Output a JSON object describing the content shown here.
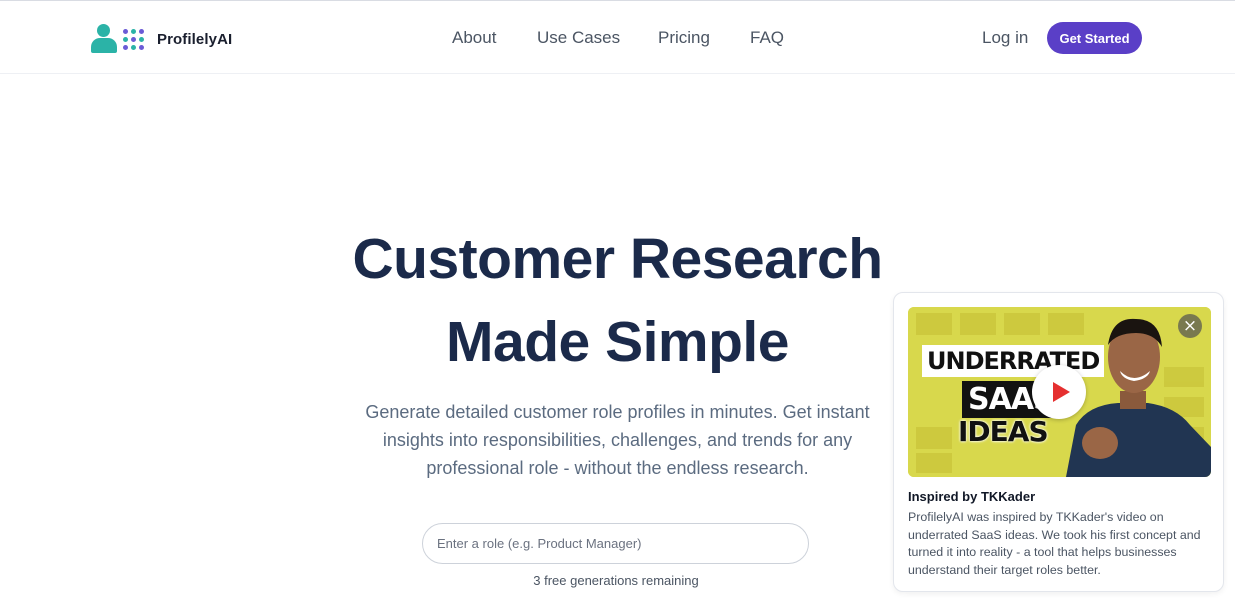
{
  "header": {
    "brand": "ProfilelyAI",
    "nav": [
      {
        "label": "About"
      },
      {
        "label": "Use Cases"
      },
      {
        "label": "Pricing"
      },
      {
        "label": "FAQ"
      }
    ],
    "login": "Log in",
    "cta": "Get Started"
  },
  "hero": {
    "title_line1": "Customer Research",
    "title_line2": "Made Simple",
    "subtitle": "Generate detailed customer role profiles in minutes. Get instant insights into responsibilities, challenges, and trends for any professional role - without the endless research.",
    "input_placeholder": "Enter a role (e.g. Product Manager)",
    "remaining": "3 free generations remaining"
  },
  "video_card": {
    "thumbnail_line1": "UNDERRATED",
    "thumbnail_line2": "SAAS",
    "thumbnail_line3": "IDEAS",
    "title": "Inspired by TKKader",
    "body": "ProfilelyAI was inspired by TKKader's video on underrated SaaS ideas. We took his first concept and turned it into reality - a tool that helps businesses understand their target roles better."
  },
  "colors": {
    "brand_purple": "#5a3fc7",
    "brand_teal": "#2bb3a7",
    "heading_navy": "#1b2a4a"
  },
  "icons": {
    "logo": "person-icon",
    "play": "play-icon",
    "close": "close-icon"
  }
}
